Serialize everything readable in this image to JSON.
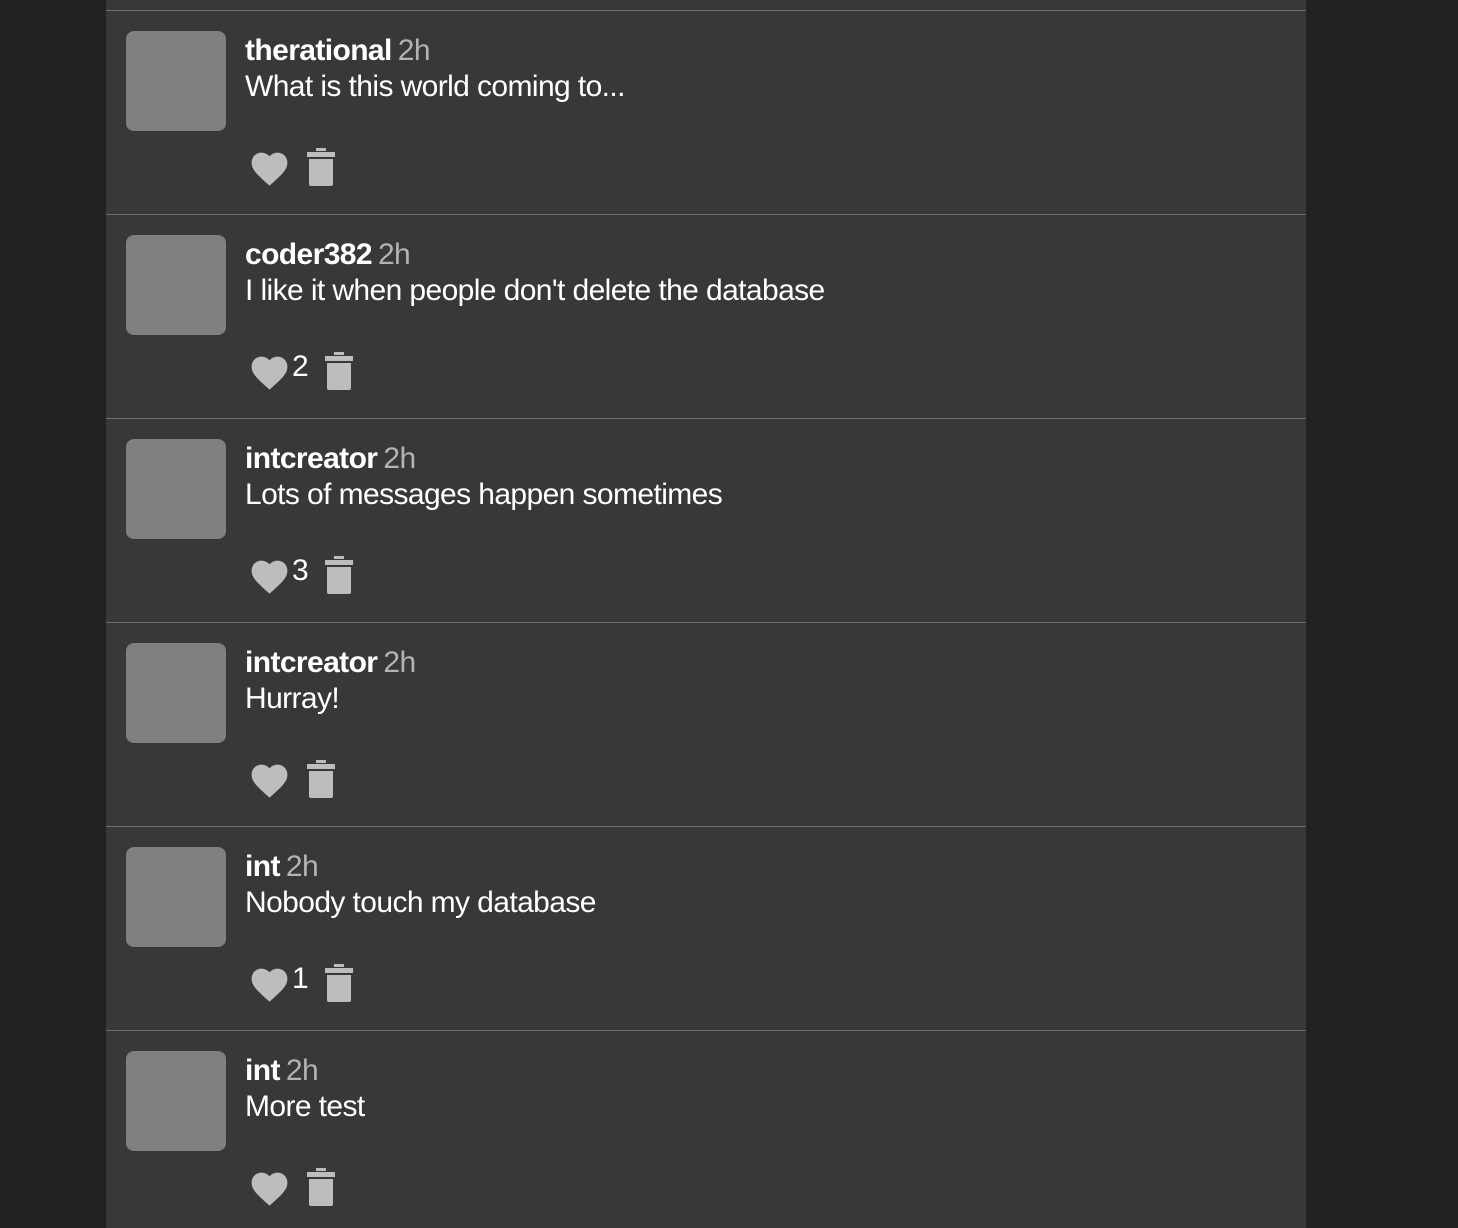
{
  "posts": [
    {
      "username": "therational",
      "time": "2h",
      "message": "What is this world coming to...",
      "likes": "",
      "heart_icon": "heart-icon",
      "delete_icon": "trash-icon"
    },
    {
      "username": "coder382",
      "time": "2h",
      "message": "I like it when people don't delete the database",
      "likes": "2",
      "heart_icon": "heart-icon",
      "delete_icon": "trash-icon"
    },
    {
      "username": "intcreator",
      "time": "2h",
      "message": "Lots of messages happen sometimes",
      "likes": "3",
      "heart_icon": "heart-icon",
      "delete_icon": "trash-icon"
    },
    {
      "username": "intcreator",
      "time": "2h",
      "message": "Hurray!",
      "likes": "",
      "heart_icon": "heart-icon",
      "delete_icon": "trash-icon"
    },
    {
      "username": "int",
      "time": "2h",
      "message": "Nobody touch my database",
      "likes": "1",
      "heart_icon": "heart-icon",
      "delete_icon": "trash-icon"
    },
    {
      "username": "int",
      "time": "2h",
      "message": "More test",
      "likes": "",
      "heart_icon": "heart-icon",
      "delete_icon": "trash-icon"
    }
  ],
  "colors": {
    "page_background": "#222222",
    "feed_background": "#383838",
    "avatar_placeholder": "#808080",
    "icon": "#bdbdbd",
    "username": "#ffffff",
    "timestamp": "#b3b3b3",
    "divider": "#6d6d6d"
  }
}
